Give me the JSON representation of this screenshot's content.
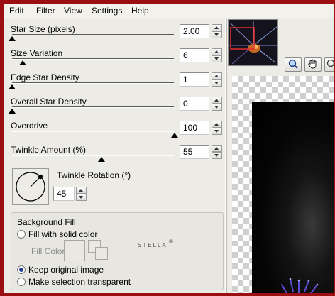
{
  "menu": {
    "items": [
      "Edit",
      "Filter",
      "View",
      "Settings",
      "Help"
    ]
  },
  "controls": {
    "star_size": {
      "label": "Star Size (pixels)",
      "value": "2.00",
      "level": 0.0
    },
    "size_variation": {
      "label": "Size Variation",
      "value": "6",
      "level": 0.06
    },
    "edge_star_density": {
      "label": "Edge Star Density",
      "value": "1",
      "level": 0.0
    },
    "overall_star_density": {
      "label": "Overall Star Density",
      "value": "0",
      "level": 0.0
    },
    "overdrive": {
      "label": "Overdrive",
      "value": "100",
      "level": 1.0
    },
    "twinkle_amount": {
      "label": "Twinkle Amount (%)",
      "value": "55",
      "level": 0.55
    }
  },
  "twinkle_rotation": {
    "label": "Twinkle Rotation (°)",
    "value": "45"
  },
  "background_fill": {
    "title": "Background Fill",
    "options": [
      {
        "label": "Fill with solid color",
        "checked": false
      },
      {
        "label": "Keep original image",
        "checked": true
      },
      {
        "label": "Make selection transparent",
        "checked": false
      }
    ],
    "fill_color_label": "Fill Color"
  },
  "brand": "STELLA",
  "colors": {
    "window_frame": "#9b0f12",
    "panel_bg": "#ecebe6",
    "radio_dot": "#1f3f8f",
    "thumbnail_selector": "#e23030"
  },
  "icons": {
    "tool_1": "zoom-pan-icon",
    "tool_2": "hand-icon",
    "tool_3": "zoom-icon"
  }
}
